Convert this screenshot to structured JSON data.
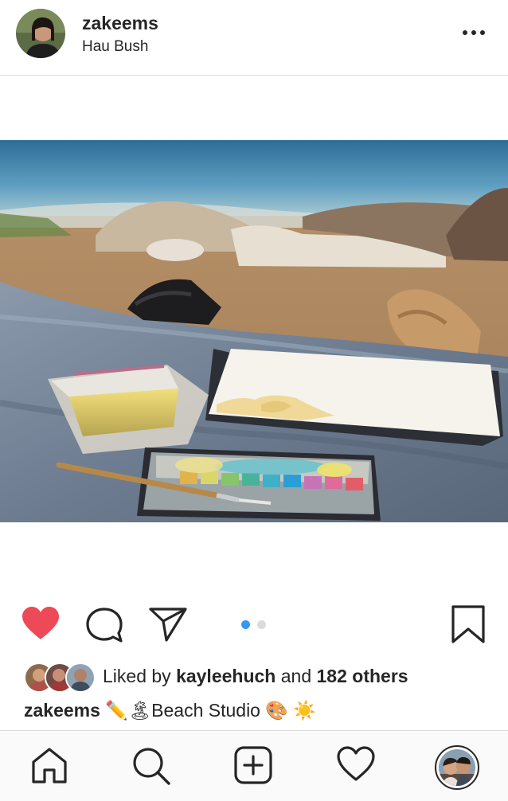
{
  "post": {
    "username": "zakeems",
    "location": "Hau Bush"
  },
  "actions": {
    "like_icon": "heart-filled-icon",
    "comment_icon": "comment-icon",
    "share_icon": "paper-plane-icon",
    "save_icon": "bookmark-icon",
    "liked_color": "#ed4956",
    "carousel": {
      "total": 2,
      "active": 1,
      "active_color": "#3897f0",
      "inactive_color": "#dbdbdb"
    }
  },
  "likes": {
    "prefix": "Liked by",
    "user": "kayleehuch",
    "middle": "and",
    "others": "182 others"
  },
  "caption": {
    "username": "zakeems",
    "emoji_pencil": "✏️",
    "emoji_island": "🏝",
    "text": "Beach Studio",
    "emoji_palette": "🎨",
    "emoji_sun": "☀️"
  },
  "tabbar": {
    "items": [
      "home-icon",
      "search-icon",
      "new-post-icon",
      "activity-icon",
      "profile-avatar"
    ]
  }
}
